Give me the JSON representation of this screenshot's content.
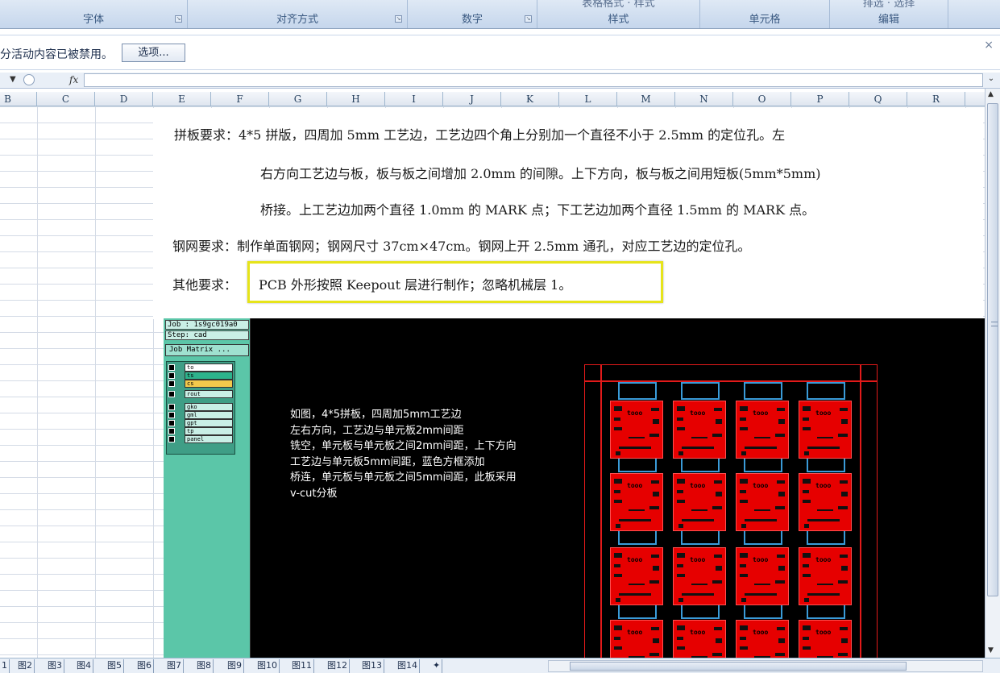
{
  "ribbon": {
    "groups": [
      {
        "label": "字体",
        "partial": "",
        "launcher": true
      },
      {
        "label": "对齐方式",
        "partial": "",
        "launcher": true
      },
      {
        "label": "数字",
        "partial": "",
        "launcher": true
      },
      {
        "label": "样式",
        "partial": "表格格式 · 样式",
        "launcher": false
      },
      {
        "label": "单元格",
        "partial": "",
        "launcher": false
      },
      {
        "label": "编辑",
        "partial": "排选 · 选择",
        "launcher": false
      }
    ]
  },
  "security_bar": {
    "message": "分活动内容已被禁用。",
    "options_button": "选项..."
  },
  "formula_bar": {
    "fx_label": "fx",
    "value": ""
  },
  "columns": [
    "B",
    "C",
    "D",
    "E",
    "F",
    "G",
    "H",
    "I",
    "J",
    "K",
    "L",
    "M",
    "N",
    "O",
    "P",
    "Q",
    "R"
  ],
  "requirements": {
    "line1": "拼板要求：4*5 拼版，四周加 5mm 工艺边，工艺边四个角上分别加一个直径不小于 2.5mm 的定位孔。左",
    "line2": "右方向工艺边与板，板与板之间增加 2.0mm 的间隙。上下方向，板与板之间用短板(5mm*5mm)",
    "line3": "桥接。上工艺边加两个直径 1.0mm 的 MARK 点；下工艺边加两个直径 1.5mm 的 MARK 点。",
    "line4": "钢网要求：制作单面钢网；钢网尺寸 37cm×47cm。钢网上开 2.5mm 通孔，对应工艺边的定位孔。",
    "line5_label": "其他要求：",
    "line5_text": "PCB 外形按照 Keepout 层进行制作；忽略机械层 1。"
  },
  "cam": {
    "job": "Job : 1s9gc019a0",
    "step": "Step: cad",
    "matrix_button": "Job Matrix ...",
    "layers": [
      {
        "name": "to",
        "color": "#ffffff"
      },
      {
        "name": "ts",
        "color": "#2db38c"
      },
      {
        "name": "cs",
        "color": "#f2c94c"
      },
      {
        "name": "rout",
        "color": "#c9efe6"
      },
      {
        "name": "gko",
        "color": "#c9efe6"
      },
      {
        "name": "gml",
        "color": "#c9efe6"
      },
      {
        "name": "gpt",
        "color": "#c9efe6"
      },
      {
        "name": "tp",
        "color": "#c9efe6"
      },
      {
        "name": "panel",
        "color": "#c9efe6"
      }
    ],
    "note_lines": [
      "如图，4*5拼板，四周加5mm工艺边",
      "左右方向，工艺边与单元板2mm间距",
      "铣空，单元板与单元板之间2mm间距，上下方向",
      "工艺边与单元板5mm间距，蓝色方框添加",
      "桥连，单元板与单元板之间5mm间距，此板采用",
      "v-cut分板"
    ],
    "board_label": "tooo",
    "colors": {
      "board": "#e60000",
      "rail": "#e21a1a",
      "bridge": "#3a9bd8",
      "panel_bg": "#5bc6a8"
    }
  },
  "sheet_tabs": [
    "1",
    "图2",
    "图3",
    "图4",
    "图5",
    "图6",
    "图7",
    "图8",
    "图9",
    "图10",
    "图11",
    "图12",
    "图13",
    "图14"
  ]
}
